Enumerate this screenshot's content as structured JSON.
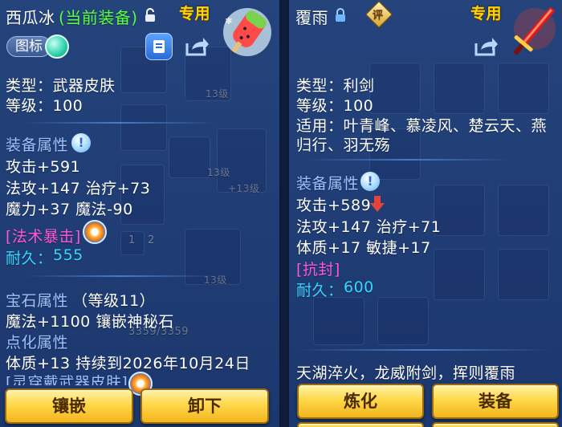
{
  "left": {
    "item_name": "西瓜冰",
    "equip_status": "(当前装备)",
    "exclusive_tag": "专用",
    "icon_badge_label": "图标",
    "type_line": "类型：武器皮肤",
    "level_line": "等级：100",
    "equip_attr_title": "装备属性",
    "stats": [
      "攻击+591",
      "法攻+147 治疗+73",
      "魔力+37 魔法-90"
    ],
    "special_skill": "[法术暴击]",
    "durability_label": "耐久：",
    "durability_value": "555",
    "gem_attr_title": "宝石属性",
    "gem_level": "（等级11）",
    "gem_line": "魔法+1100 镶嵌神秘石",
    "enhance_title": "点化属性",
    "enhance_line": "体质+13 持续到2026年10月24日",
    "cut_line": "[灵穿戴武器皮肤]",
    "buttons": [
      "镶嵌",
      "卸下"
    ],
    "bg_hints": [
      "13级",
      "13级",
      "+13级",
      "13级",
      "3359/3359",
      "1",
      "2"
    ]
  },
  "right": {
    "item_name": "覆雨",
    "rating_glyph": "评",
    "exclusive_tag": "专用",
    "type_line": "类型：利剑",
    "level_line": "等级：100",
    "apply_line1": "适用：叶青峰、慕凌风、楚云天、燕",
    "apply_line2": "归行、羽无殇",
    "equip_attr_title": "装备属性",
    "stats": [
      "攻击+589",
      "法攻+147 治疗+71",
      "体质+17 敏捷+17"
    ],
    "special_skill": "[抗封]",
    "durability_label": "耐久：",
    "durability_value": "600",
    "flavor_text": "天湖淬火，龙威附剑，挥则覆雨",
    "buttons": [
      "炼化",
      "装备"
    ]
  },
  "colors": {
    "section": "#9ec3ff",
    "magenta": "#ff58d8",
    "cyan": "#37d8ff",
    "green": "#58ff3a",
    "gold": "#ffd400",
    "button_gold": "#ffd84a",
    "down_arrow": "#e0443c"
  }
}
